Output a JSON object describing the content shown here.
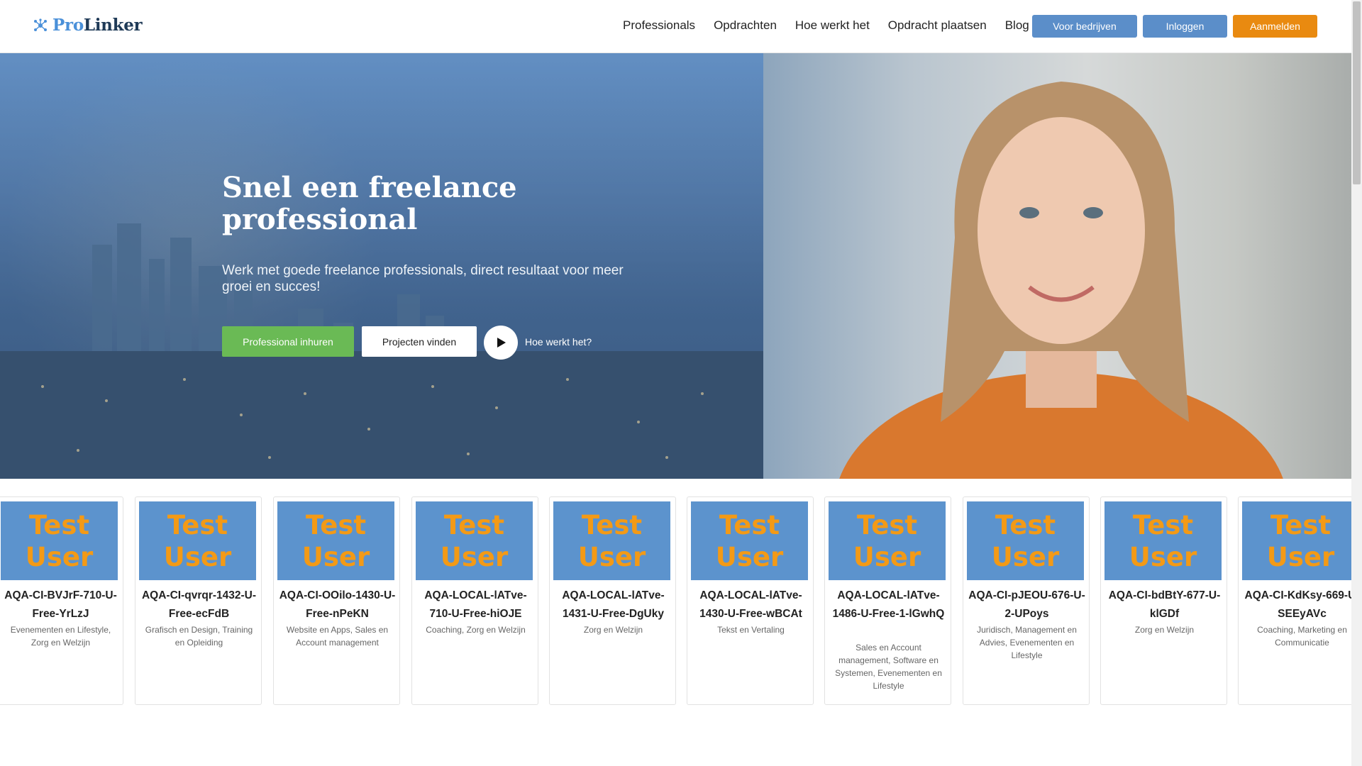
{
  "header": {
    "logo_part1": "Pro",
    "logo_part2": "Linker",
    "nav": [
      "Professionals",
      "Opdrachten",
      "Hoe werkt het",
      "Opdracht plaatsen",
      "Blog"
    ],
    "btn_companies": "Voor bedrijven",
    "btn_login": "Inloggen",
    "btn_signup": "Aanmelden"
  },
  "hero": {
    "title": "Snel een freelance professional",
    "subtitle": "Werk met goede freelance professionals, direct resultaat voor meer groei en succes!",
    "btn_hire": "Professional inhuren",
    "btn_projects": "Projecten vinden",
    "how_label": "Hoe werkt het?"
  },
  "cards": [
    {
      "img_line1": "Test",
      "img_line2": "User",
      "name": "AQA-CI-BVJrF-710-U-Free-YrLzJ",
      "category": "Evenementen en Lifestyle, Zorg en Welzijn"
    },
    {
      "img_line1": "Test",
      "img_line2": "User",
      "name": "AQA-CI-qvrqr-1432-U-Free-ecFdB",
      "category": "Grafisch en Design, Training en Opleiding"
    },
    {
      "img_line1": "Test",
      "img_line2": "User",
      "name": "AQA-CI-OOilo-1430-U-Free-nPeKN",
      "category": "Website en Apps, Sales en Account management"
    },
    {
      "img_line1": "Test",
      "img_line2": "User",
      "name": "AQA-LOCAL-lATve-710-U-Free-hiOJE",
      "category": "Coaching, Zorg en Welzijn"
    },
    {
      "img_line1": "Test",
      "img_line2": "User",
      "name": "AQA-LOCAL-lATve-1431-U-Free-DgUky",
      "category": "Zorg en Welzijn"
    },
    {
      "img_line1": "Test",
      "img_line2": "User",
      "name": "AQA-LOCAL-lATve-1430-U-Free-wBCAt",
      "category": "Tekst en Vertaling"
    },
    {
      "img_line1": "Test",
      "img_line2": "User",
      "name": "AQA-LOCAL-lATve-1486-U-Free-1-lGwhQ",
      "category": "Sales en Account management, Software en Systemen, Evenementen en Lifestyle"
    },
    {
      "img_line1": "Test",
      "img_line2": "User",
      "name": "AQA-CI-pJEOU-676-U-2-UPoys",
      "category": "Juridisch, Management en Advies, Evenementen en Lifestyle"
    },
    {
      "img_line1": "Test",
      "img_line2": "User",
      "name": "AQA-CI-bdBtY-677-U-klGDf",
      "category": "Zorg en Welzijn"
    },
    {
      "img_line1": "Test",
      "img_line2": "User",
      "name": "AQA-CI-KdKsy-669-U-SEEyAVc",
      "category": "Coaching, Marketing en Communicatie"
    }
  ]
}
